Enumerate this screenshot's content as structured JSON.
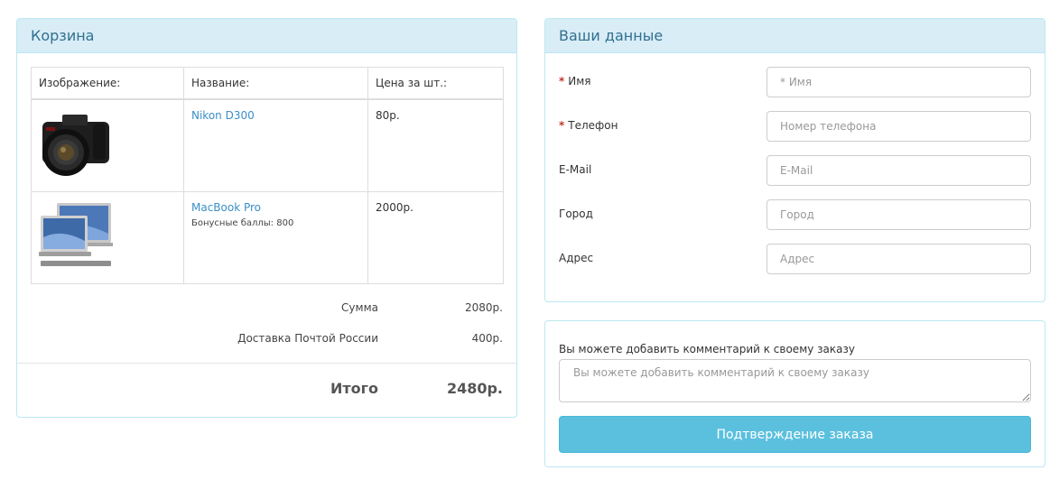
{
  "cart": {
    "title": "Корзина",
    "headers": {
      "image": "Изображение:",
      "name": "Название:",
      "price": "Цена за шт.:"
    },
    "items": [
      {
        "name": "Nikon D300",
        "bonus": "",
        "price": "80р.",
        "image_icon": "camera-image"
      },
      {
        "name": "MacBook Pro",
        "bonus": "Бонусные баллы: 800",
        "price": "2000р.",
        "image_icon": "laptop-image"
      }
    ],
    "totals": {
      "sum_label": "Сумма",
      "sum_value": "2080р.",
      "delivery_label": "Доставка Почтой России",
      "delivery_value": "400р.",
      "total_label": "Итого",
      "total_value": "2480р."
    }
  },
  "customer": {
    "title": "Ваши данные",
    "fields": [
      {
        "required_mark": "*",
        "label": "Имя",
        "placeholder": "* Имя"
      },
      {
        "required_mark": "*",
        "label": "Телефон",
        "placeholder": "Номер телефона"
      },
      {
        "required_mark": "",
        "label": "E-Mail",
        "placeholder": "E-Mail"
      },
      {
        "required_mark": "",
        "label": "Город",
        "placeholder": "Город"
      },
      {
        "required_mark": "",
        "label": "Адрес",
        "placeholder": "Адрес"
      }
    ]
  },
  "comment": {
    "label": "Вы можете добавить комментарий к своему заказу",
    "placeholder": "Вы можете добавить комментарий к своему заказу",
    "submit_label": "Подтверждение заказа"
  },
  "colors": {
    "panel_heading_bg": "#d9edf7",
    "panel_border": "#bce8f1",
    "heading_text": "#31708f",
    "link": "#3a8fc8",
    "required": "#c0392b",
    "button": "#5bc0de"
  }
}
